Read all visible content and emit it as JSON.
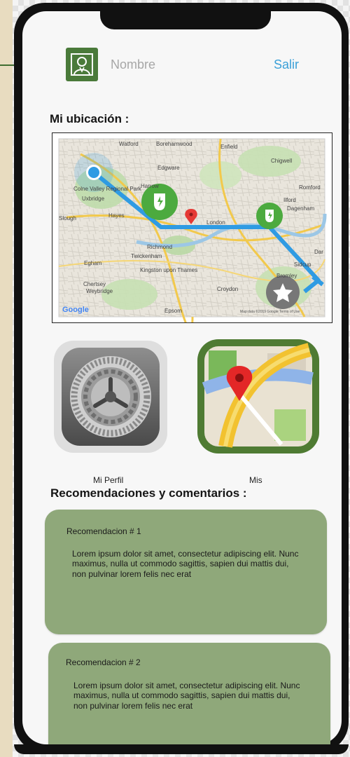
{
  "header": {
    "name_placeholder": "Nombre",
    "logout_label": "Salir"
  },
  "location": {
    "title": "Mi ubicación :",
    "map": {
      "place_labels": [
        "Watford",
        "Borehamwood",
        "Enfield",
        "Edgware",
        "Chigwell",
        "Harrow",
        "Romford",
        "Colne Valley Regional Park",
        "Uxbridge",
        "Ilford",
        "Dagenham",
        "Hayes",
        "London",
        "Slough",
        "Richmond",
        "Twickenham",
        "Egham",
        "Kingston upon Thames",
        "Sidcup",
        "Bromley",
        "Chertsey",
        "Weybridge",
        "Croydon",
        "Epsom",
        "Dar"
      ],
      "google_label": "Google",
      "attribution": "Map data ©2019 Google   Terms of Use",
      "route_color": "#2f9be3",
      "charger_color": "#4caa3f",
      "marker_color": "#e53935"
    }
  },
  "shortcuts": {
    "profile_label": "Mi Perfil",
    "maps_label": "Mis"
  },
  "recommendations": {
    "title": "Recomendaciones y comentarios :",
    "items": [
      {
        "title": "Recomendacion # 1",
        "body": "Lorem ipsum dolor sit amet, consectetur adipiscing elit. Nunc maximus, nulla ut commodo sagittis, sapien dui mattis dui, non pulvinar lorem felis nec erat"
      },
      {
        "title": "Recomendacion # 2",
        "body": "Lorem ipsum dolor sit amet, consectetur adipiscing elit. Nunc maximus, nulla ut commodo sagittis, sapien dui mattis dui, non pulvinar lorem felis nec erat"
      }
    ]
  },
  "colors": {
    "accent_blue": "#3aa0d8",
    "card_green": "#8fa87a",
    "avatar_green": "#4a7a3a"
  }
}
